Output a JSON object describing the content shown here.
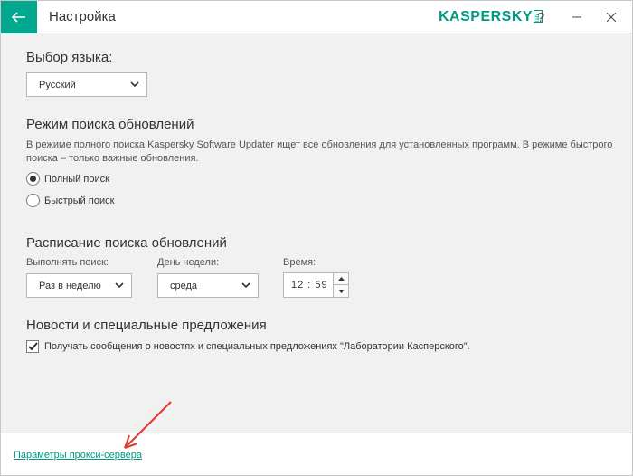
{
  "titlebar": {
    "title": "Настройка",
    "logo": "KASPERSKY",
    "logo_lab": "lab",
    "help": "?",
    "minimize": "—",
    "close": "✕",
    "accent_color": "#00a88e"
  },
  "language": {
    "heading": "Выбор языка:",
    "selected": "Русский"
  },
  "search_mode": {
    "heading": "Режим поиска обновлений",
    "description": "В режиме полного поиска Kaspersky Software Updater ищет все обновления для установленных программ. В режиме быстрого поиска – только важные обновления.",
    "options": [
      {
        "label": "Полный поиск",
        "selected": true
      },
      {
        "label": "Быстрый поиск",
        "selected": false
      }
    ]
  },
  "schedule": {
    "heading": "Расписание поиска обновлений",
    "run_label": "Выполнять поиск:",
    "run_value": "Раз в неделю",
    "day_label": "День недели:",
    "day_value": "среда",
    "time_label": "Время:",
    "time_value": "12 : 59"
  },
  "news": {
    "heading": "Новости и специальные предложения",
    "checkbox_label": "Получать сообщения о новостях и специальных предложениях \"Лаборатории Касперского\".",
    "checked": true
  },
  "footer": {
    "proxy_link": "Параметры прокси-сервера"
  },
  "annotation": {
    "arrow_color": "#e03b2e"
  }
}
